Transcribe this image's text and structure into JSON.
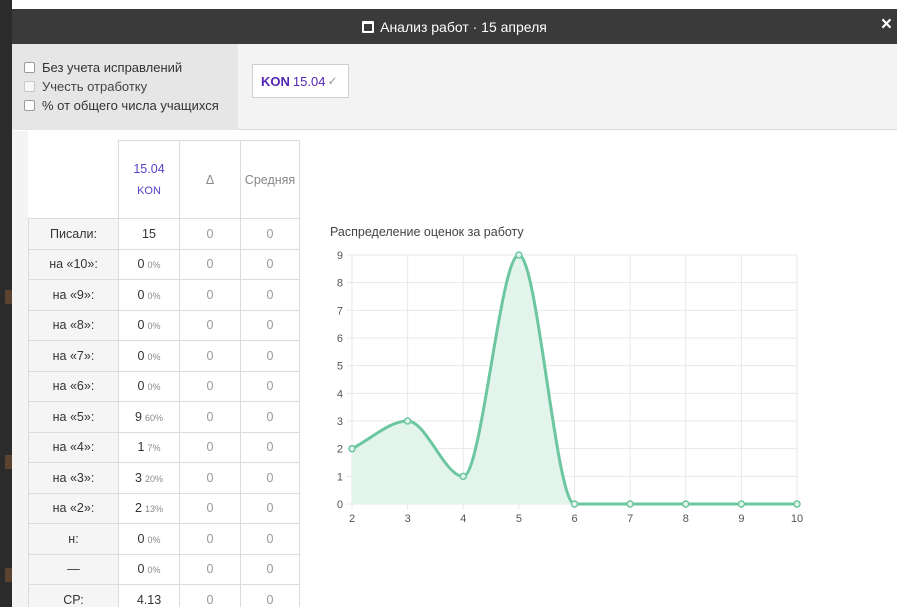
{
  "window": {
    "title": "Анализ работ · 15 апреля",
    "close_symbol": "×"
  },
  "options": [
    {
      "label": "Без учета исправлений",
      "checked": false,
      "enabled": true
    },
    {
      "label": "Учесть отработку",
      "checked": false,
      "enabled": false
    },
    {
      "label": "% от общего числа учащихся",
      "checked": false,
      "enabled": true
    }
  ],
  "work_chip": {
    "code": "KON",
    "date": "15.04",
    "check": "✓"
  },
  "table": {
    "header": {
      "col1_date": "15.04",
      "col1_code": "KON",
      "col2": "Δ",
      "col3": "Средняя"
    },
    "rows": [
      {
        "label": "Писали:",
        "value": "15",
        "pct": "",
        "delta": "0",
        "avg": "0"
      },
      {
        "label": "на «10»:",
        "value": "0",
        "pct": "0%",
        "delta": "0",
        "avg": "0"
      },
      {
        "label": "на «9»:",
        "value": "0",
        "pct": "0%",
        "delta": "0",
        "avg": "0"
      },
      {
        "label": "на «8»:",
        "value": "0",
        "pct": "0%",
        "delta": "0",
        "avg": "0"
      },
      {
        "label": "на «7»:",
        "value": "0",
        "pct": "0%",
        "delta": "0",
        "avg": "0"
      },
      {
        "label": "на «6»:",
        "value": "0",
        "pct": "0%",
        "delta": "0",
        "avg": "0"
      },
      {
        "label": "на «5»:",
        "value": "9",
        "pct": "60%",
        "delta": "0",
        "avg": "0"
      },
      {
        "label": "на «4»:",
        "value": "1",
        "pct": "7%",
        "delta": "0",
        "avg": "0"
      },
      {
        "label": "на «3»:",
        "value": "3",
        "pct": "20%",
        "delta": "0",
        "avg": "0"
      },
      {
        "label": "на «2»:",
        "value": "2",
        "pct": "13%",
        "delta": "0",
        "avg": "0"
      },
      {
        "label": "н:",
        "value": "0",
        "pct": "0%",
        "delta": "0",
        "avg": "0"
      },
      {
        "label": "—",
        "value": "0",
        "pct": "0%",
        "delta": "0",
        "avg": "0"
      },
      {
        "label": "СР:",
        "value": "4.13",
        "pct": "",
        "delta": "0",
        "avg": "0"
      }
    ]
  },
  "chart_data": {
    "type": "area",
    "title": "Распределение оценок за работу",
    "x": [
      2,
      3,
      4,
      5,
      6,
      7,
      8,
      9,
      10
    ],
    "y": [
      2,
      3,
      1,
      9,
      0,
      0,
      0,
      0,
      0
    ],
    "xlim": [
      2,
      10
    ],
    "ylim": [
      0,
      9
    ],
    "yticks": [
      0,
      1,
      2,
      3,
      4,
      5,
      6,
      7,
      8,
      9
    ],
    "grid": true,
    "legend": "none",
    "line_color": "#6cc6a0",
    "fill_color": "#e2f4ec"
  }
}
